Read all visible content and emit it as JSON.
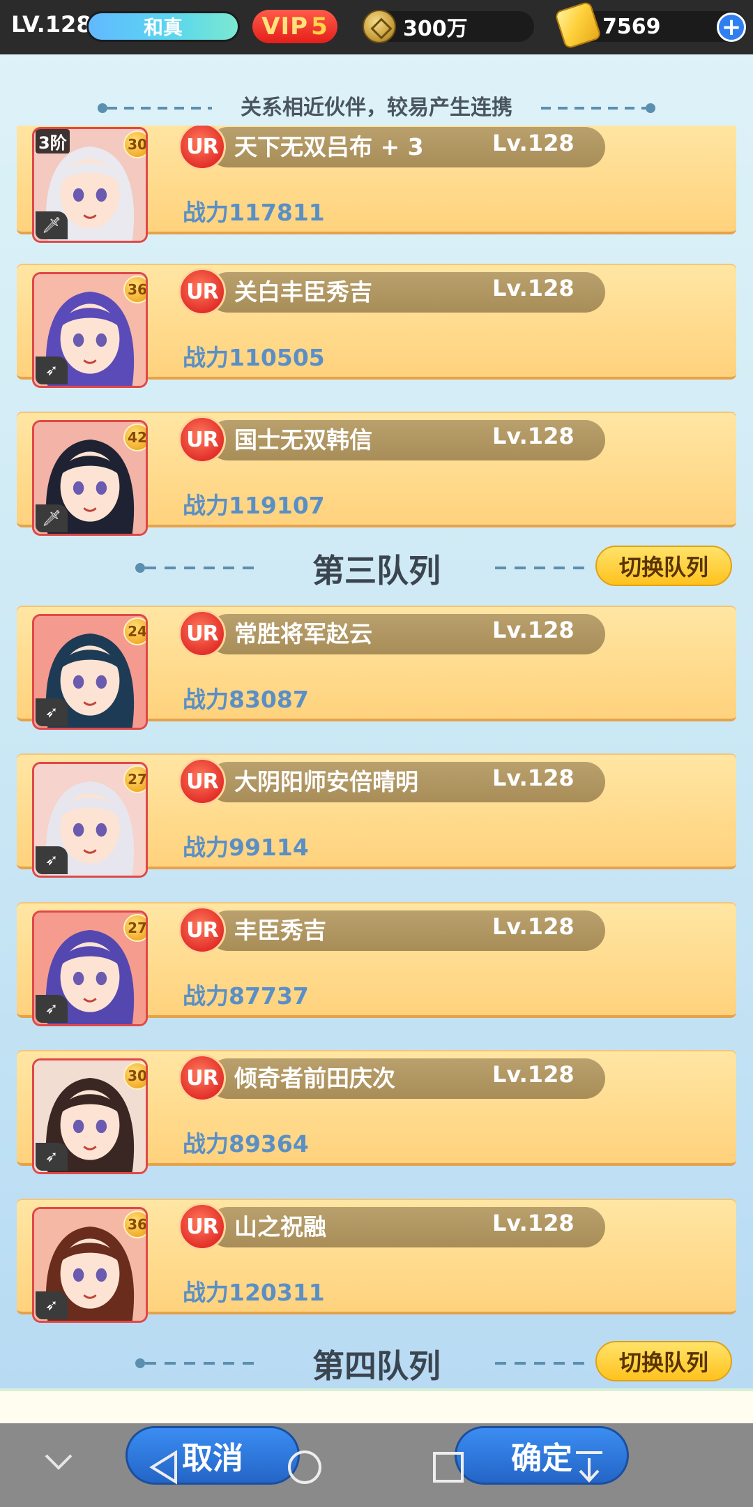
{
  "player": {
    "level": "LV.128",
    "name": "和真",
    "vip_label": "VIP",
    "vip_level": "5"
  },
  "resources": {
    "coins": "300万",
    "gold": "7569",
    "plus": "+"
  },
  "hint": "关系相近伙伴，较易产生连携",
  "teams": [
    {
      "title": "第三队列",
      "switch_label": "切换队列"
    },
    {
      "title": "第四队列",
      "switch_label": "切换队列"
    }
  ],
  "heroes": [
    {
      "name": "天下无双吕布 + 3",
      "rarity": "UR",
      "level": "Lv.128",
      "power": "战力117811",
      "badge": "30",
      "tier": "3阶",
      "role": "sword",
      "hair": "#e9e9ef",
      "bg": "#f3c9c0"
    },
    {
      "name": "关白丰臣秀吉",
      "rarity": "UR",
      "level": "Lv.128",
      "power": "战力110505",
      "badge": "36",
      "tier": "",
      "role": "wing",
      "hair": "#5b4bb8",
      "bg": "#f7b9a8"
    },
    {
      "name": "国士无双韩信",
      "rarity": "UR",
      "level": "Lv.128",
      "power": "战力119107",
      "badge": "42",
      "tier": "",
      "role": "sword",
      "hair": "#1f2233",
      "bg": "#f3b3a6"
    },
    {
      "name": "常胜将军赵云",
      "rarity": "UR",
      "level": "Lv.128",
      "power": "战力83087",
      "badge": "24",
      "tier": "",
      "role": "wing",
      "hair": "#1e3b55",
      "bg": "#f59a8e"
    },
    {
      "name": "大阴阳师安倍晴明",
      "rarity": "UR",
      "level": "Lv.128",
      "power": "战力99114",
      "badge": "27",
      "tier": "",
      "role": "wing",
      "hair": "#e7e6ee",
      "bg": "#f6d3cc"
    },
    {
      "name": "丰臣秀吉",
      "rarity": "UR",
      "level": "Lv.128",
      "power": "战力87737",
      "badge": "27",
      "tier": "",
      "role": "wing",
      "hair": "#5547b0",
      "bg": "#f59c8e"
    },
    {
      "name": "倾奇者前田庆次",
      "rarity": "UR",
      "level": "Lv.128",
      "power": "战力89364",
      "badge": "30",
      "tier": "",
      "role": "wing",
      "hair": "#3a2723",
      "bg": "#f2ddd3"
    },
    {
      "name": "山之祝融",
      "rarity": "UR",
      "level": "Lv.128",
      "power": "战力120311",
      "badge": "36",
      "tier": "",
      "role": "wing",
      "hair": "#6a2c1c",
      "bg": "#f5b8a4"
    }
  ],
  "actions": {
    "cancel": "取消",
    "confirm": "确定"
  }
}
